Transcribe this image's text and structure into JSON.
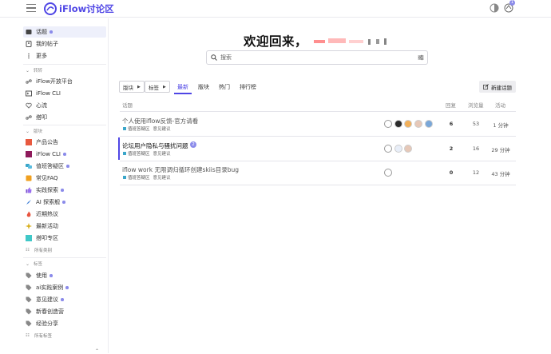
{
  "header": {
    "brand": "iFlow讨论区",
    "notification_count": "1"
  },
  "sidebar": {
    "top_items": [
      {
        "label": "话题",
        "icon": "topics-icon",
        "dot": true,
        "active": true
      },
      {
        "label": "我的帖子",
        "icon": "user-icon",
        "dot": false
      },
      {
        "label": "更多",
        "icon": "more-icon",
        "dot": false
      }
    ],
    "sections": [
      {
        "title": "转转",
        "items": [
          {
            "label": "iFlow开放平台",
            "icon": "link-icon",
            "color": "#777777"
          },
          {
            "label": "iFlow CLI",
            "icon": "terminal-icon",
            "color": "#555555"
          },
          {
            "label": "心流",
            "icon": "heart-icon",
            "color": "#777777"
          },
          {
            "label": "搭叩",
            "icon": "link-icon",
            "color": "#777777"
          }
        ]
      },
      {
        "title": "版块",
        "items": [
          {
            "label": "产品公告",
            "icon": "square-icon",
            "color": "#e8593f",
            "dot": false
          },
          {
            "label": "iFlow CLI",
            "icon": "square-icon",
            "color": "#8e1a5b",
            "dot": true
          },
          {
            "label": "值班答疑区",
            "icon": "chat-icon",
            "color": "#3aa6c9",
            "dot": true
          },
          {
            "label": "常见FAQ",
            "icon": "faq-icon",
            "color": "#f0a020",
            "dot": false
          },
          {
            "label": "实践探索",
            "icon": "thumb-icon",
            "color": "#7a4fd0",
            "dot": true
          },
          {
            "label": "AI 探索舰",
            "icon": "rocket-icon",
            "color": "#3a7bd5",
            "dot": true
          },
          {
            "label": "近期热议",
            "icon": "fire-icon",
            "color": "#e8553f",
            "dot": false
          },
          {
            "label": "最新活动",
            "icon": "sparkle-icon",
            "color": "#d8b020",
            "dot": false
          },
          {
            "label": "搭叩专区",
            "icon": "square-icon",
            "color": "#40c8c8",
            "dot": false
          }
        ],
        "footer": "所有类别"
      },
      {
        "title": "标签",
        "items": [
          {
            "label": "使用",
            "icon": "tag-icon",
            "dot": true
          },
          {
            "label": "ai实践案例",
            "icon": "tag-icon",
            "dot": true
          },
          {
            "label": "意见建议",
            "icon": "tag-icon",
            "dot": true
          },
          {
            "label": "新春创造营",
            "icon": "tag-icon",
            "dot": false
          },
          {
            "label": "经验分享",
            "icon": "tag-icon",
            "dot": false
          }
        ],
        "footer": "所有标签"
      }
    ]
  },
  "main": {
    "welcome": "欢迎回来，",
    "search_placeholder": "搜索",
    "filters": {
      "category": "版块",
      "tags": "标签"
    },
    "tabs": [
      "最新",
      "版块",
      "热门",
      "排行榜"
    ],
    "new_topic": "新建话题",
    "columns": {
      "topic": "话题",
      "replies": "回复",
      "views": "浏览量",
      "activity": "活动"
    },
    "topics": [
      {
        "title": "个人使用iflow反馈-官方请看",
        "category": "值班答疑区",
        "tag": "意见建议",
        "replies": "6",
        "views": "53",
        "activity": "1 分钟",
        "unread": false,
        "badge": ""
      },
      {
        "title": "论坛用户隐私与骚扰问题",
        "category": "值班答疑区",
        "tag": "意见建议",
        "replies": "2",
        "views": "16",
        "activity": "29 分钟",
        "unread": true,
        "badge": "2"
      },
      {
        "title": "iflow work 无限调归循环创建skiis目录bug",
        "category": "值班答疑区",
        "tag": "意见建议",
        "replies": "0",
        "views": "12",
        "activity": "43 分钟",
        "unread": false,
        "badge": ""
      }
    ]
  },
  "colors": {
    "accent": "#4f46e5",
    "dot": "#8b8bea"
  }
}
